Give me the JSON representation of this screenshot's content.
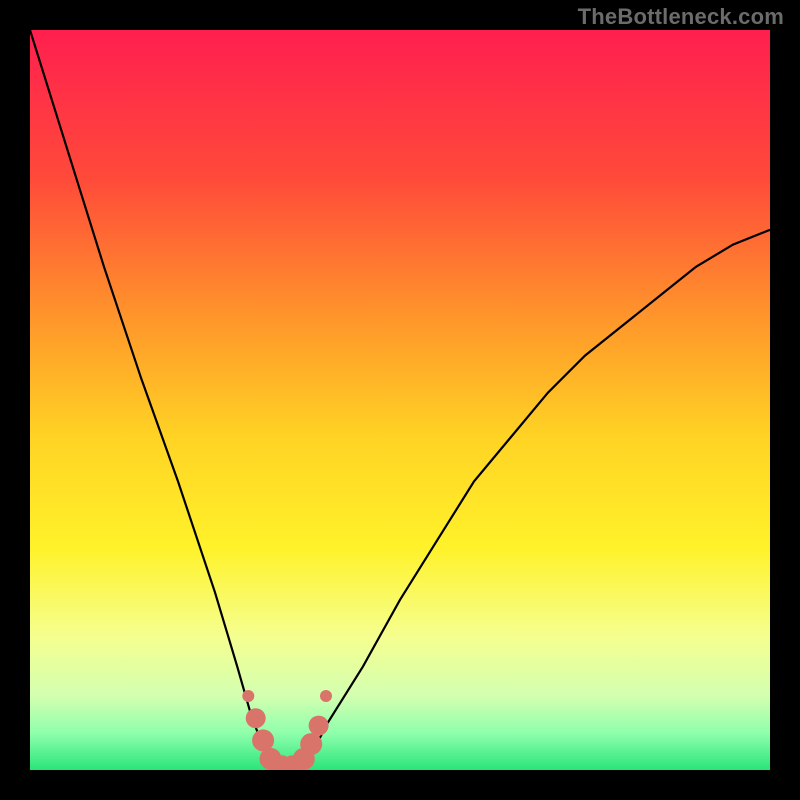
{
  "watermark": "TheBottleneck.com",
  "chart_data": {
    "type": "line",
    "title": "",
    "xlabel": "",
    "ylabel": "",
    "xlim": [
      0,
      100
    ],
    "ylim": [
      0,
      100
    ],
    "background_gradient": {
      "stops": [
        {
          "offset": 0.0,
          "color": "#ff1f4f"
        },
        {
          "offset": 0.2,
          "color": "#ff4a3a"
        },
        {
          "offset": 0.4,
          "color": "#ff9a2a"
        },
        {
          "offset": 0.55,
          "color": "#ffd324"
        },
        {
          "offset": 0.7,
          "color": "#fff22a"
        },
        {
          "offset": 0.82,
          "color": "#f5ff90"
        },
        {
          "offset": 0.9,
          "color": "#d3ffb0"
        },
        {
          "offset": 0.95,
          "color": "#8fffac"
        },
        {
          "offset": 1.0,
          "color": "#29e57a"
        }
      ]
    },
    "curve": {
      "description": "V-shaped bottleneck curve; y is high (bad) at low and high x, dipping to ~0 near x≈34",
      "x": [
        0,
        5,
        10,
        15,
        20,
        25,
        28,
        30,
        32,
        34,
        36,
        38,
        40,
        45,
        50,
        55,
        60,
        65,
        70,
        75,
        80,
        85,
        90,
        95,
        100
      ],
      "y": [
        100,
        84,
        68,
        53,
        39,
        24,
        14,
        7,
        2,
        0,
        0,
        2,
        6,
        14,
        23,
        31,
        39,
        45,
        51,
        56,
        60,
        64,
        68,
        71,
        73
      ]
    },
    "markers": {
      "description": "Highlighted salmon-colored segment near trough",
      "color": "#d9746b",
      "radius_small": 5,
      "radius_large": 11,
      "points": [
        {
          "x": 29.5,
          "y": 10.0,
          "r": 6
        },
        {
          "x": 30.5,
          "y": 7.0,
          "r": 10
        },
        {
          "x": 31.5,
          "y": 4.0,
          "r": 11
        },
        {
          "x": 32.5,
          "y": 1.5,
          "r": 11
        },
        {
          "x": 34.0,
          "y": 0.5,
          "r": 11
        },
        {
          "x": 35.5,
          "y": 0.5,
          "r": 11
        },
        {
          "x": 37.0,
          "y": 1.5,
          "r": 11
        },
        {
          "x": 38.0,
          "y": 3.5,
          "r": 11
        },
        {
          "x": 39.0,
          "y": 6.0,
          "r": 10
        },
        {
          "x": 40.0,
          "y": 10.0,
          "r": 6
        }
      ]
    }
  }
}
